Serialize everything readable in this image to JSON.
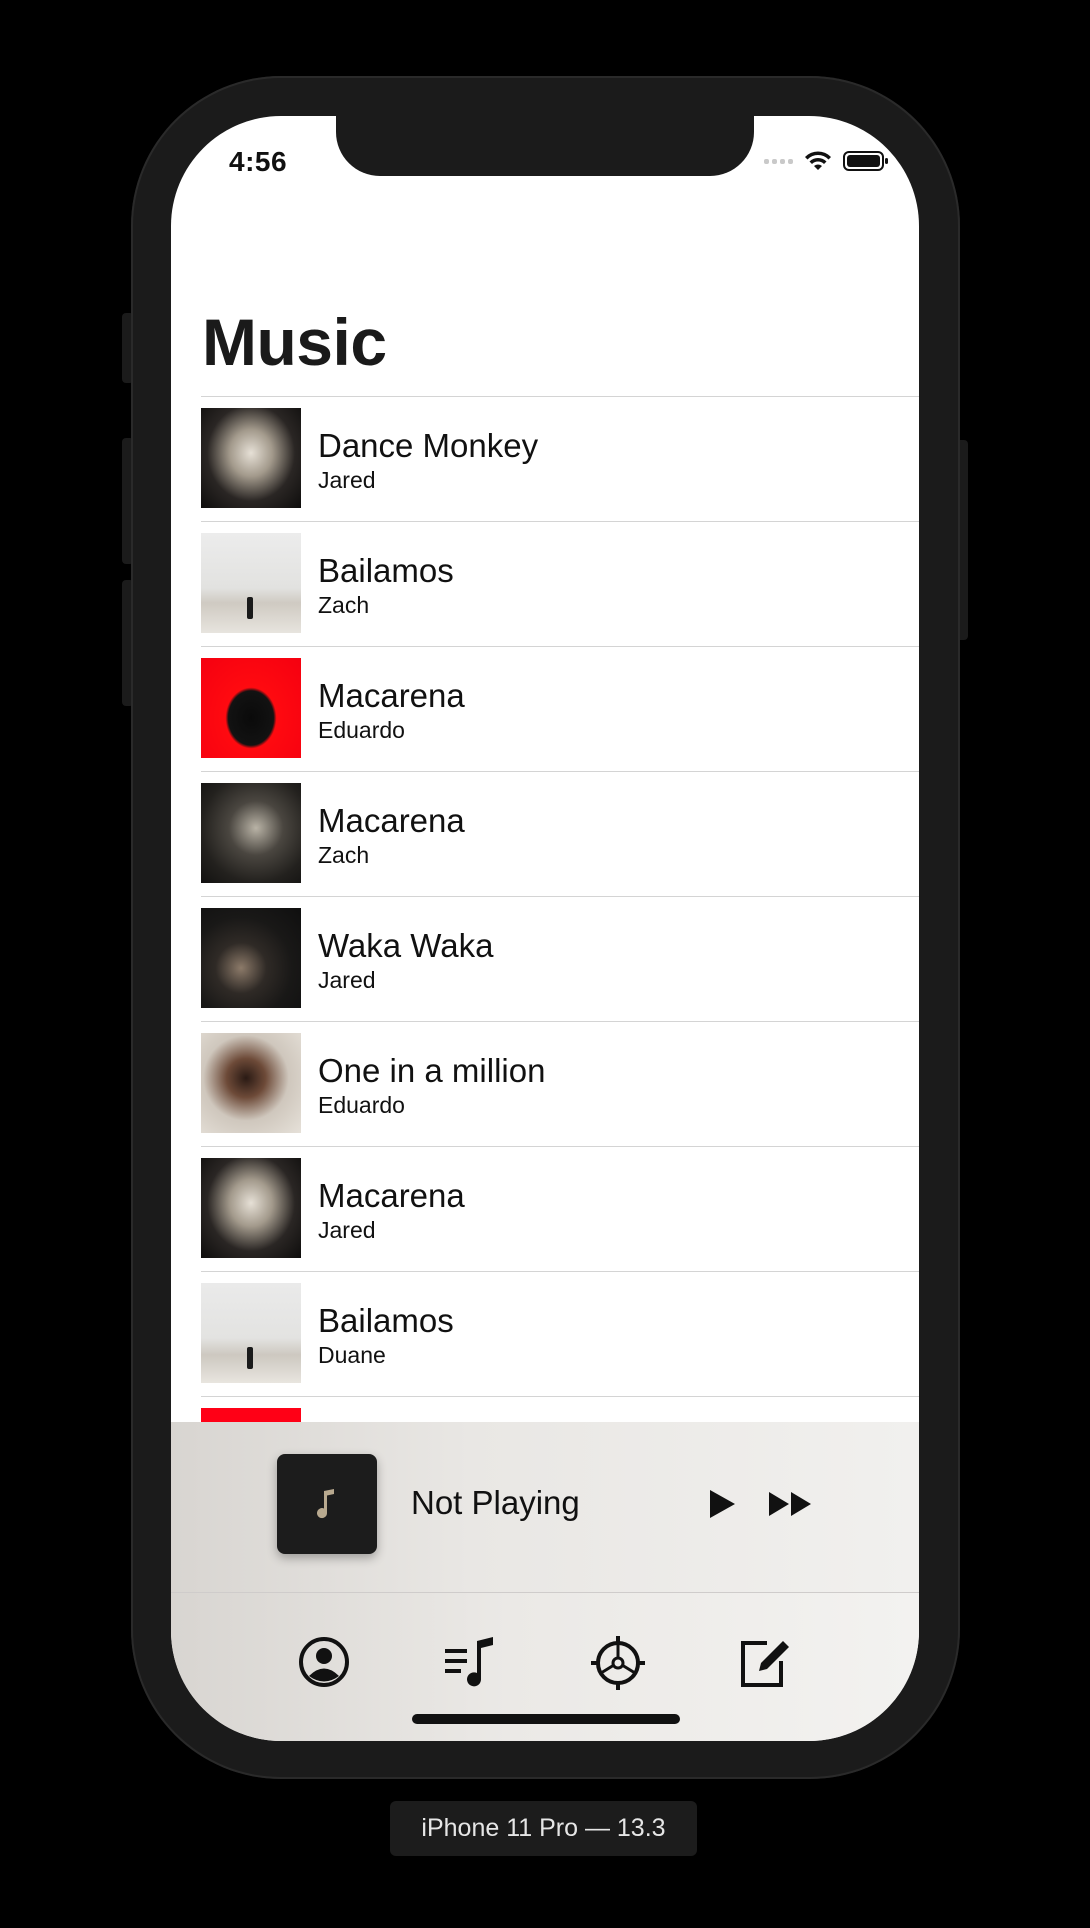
{
  "status_bar": {
    "time": "4:56",
    "icons": [
      "cellular-signal-icon",
      "wifi-icon",
      "battery-icon"
    ]
  },
  "page": {
    "title": "Music"
  },
  "songs": [
    {
      "title": "Dance Monkey",
      "artist": "Jared",
      "art": "album-art-hands"
    },
    {
      "title": "Bailamos",
      "artist": "Zach",
      "art": "album-art-beach"
    },
    {
      "title": "Macarena",
      "artist": "Eduardo",
      "art": "album-art-red"
    },
    {
      "title": "Macarena",
      "artist": "Zach",
      "art": "album-art-portrait"
    },
    {
      "title": "Waka Waka",
      "artist": "Jared",
      "art": "album-art-city"
    },
    {
      "title": "One in a million",
      "artist": "Eduardo",
      "art": "album-art-flowers"
    },
    {
      "title": "Macarena",
      "artist": "Jared",
      "art": "album-art-hands"
    },
    {
      "title": "Bailamos",
      "artist": "Duane",
      "art": "album-art-beach"
    }
  ],
  "mini_player": {
    "title": "Not Playing",
    "art_icon": "music-note-icon",
    "controls": [
      "play-icon",
      "fast-forward-icon"
    ]
  },
  "tab_bar": {
    "items": [
      {
        "icon": "profile-icon"
      },
      {
        "icon": "playlist-icon"
      },
      {
        "icon": "settings-icon"
      },
      {
        "icon": "compose-icon"
      }
    ]
  },
  "device_label": "iPhone 11 Pro — 13.3",
  "colors": {
    "background": "#000000",
    "device_frame": "#1b1b1b",
    "text_primary": "#111111",
    "separator": "#d4d4d4",
    "accent_red": "#ff0016"
  }
}
